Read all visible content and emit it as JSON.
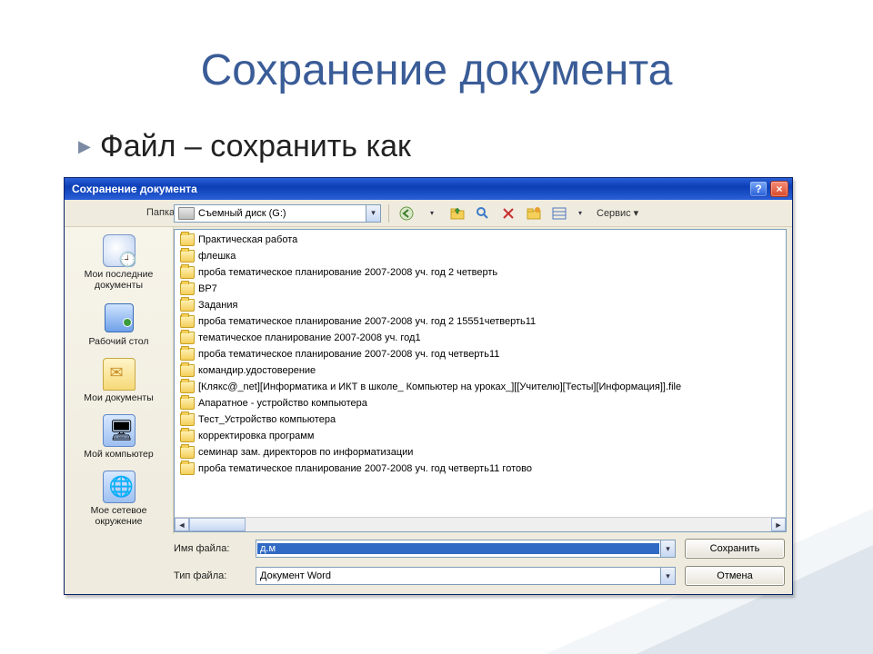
{
  "slide": {
    "title": "Сохранение документа",
    "bullet_prefix": "▶",
    "bullet_text": "Файл – сохранить как"
  },
  "dialog": {
    "title": "Сохранение документа",
    "help_btn": "?",
    "close_btn": "×",
    "folder_label": "Папка:",
    "folder_value": "Съемный диск (G:)",
    "toolbar": {
      "tools_label": "Сервис",
      "tools_arrow": "▾"
    },
    "places": [
      {
        "label": "Мои последние документы"
      },
      {
        "label": "Рабочий стол"
      },
      {
        "label": "Мои документы"
      },
      {
        "label": "Мой компьютер"
      },
      {
        "label": "Мое сетевое окружение"
      }
    ],
    "files": [
      {
        "t": "folder",
        "name": "Практическая работа"
      },
      {
        "t": "folder",
        "name": "флешка"
      },
      {
        "t": "folder",
        "name": "проба тематическое планирование 2007-2008 уч. год 2 четверть"
      },
      {
        "t": "folder",
        "name": "ВР7"
      },
      {
        "t": "folder",
        "name": "Задания"
      },
      {
        "t": "folder",
        "name": "проба тематическое планирование 2007-2008 уч. год 2 15551четверть11"
      },
      {
        "t": "folder",
        "name": "тематическое планирование 2007-2008 уч. год1"
      },
      {
        "t": "folder",
        "name": "проба тематическое планирование 2007-2008 уч. год четверть11"
      },
      {
        "t": "folder",
        "name": "командир.удостоверение"
      },
      {
        "t": "folder",
        "name": "[Клякс@_net][Информатика и ИКТ в школе_ Компьютер на уроках_][[Учителю][Тесты][Информация]].file"
      },
      {
        "t": "folder",
        "name": "Апаратное - устройство компьютера"
      },
      {
        "t": "folder",
        "name": "Тест_Устройство компьютера"
      },
      {
        "t": "folder",
        "name": "корректировка программ"
      },
      {
        "t": "folder",
        "name": "семинар зам. директоров по информатизации"
      },
      {
        "t": "folder",
        "name": "проба тематическое планирование 2007-2008 уч. год четверть11 готово"
      }
    ],
    "scroll_left": "◄",
    "scroll_right": "►",
    "filename_label": "Имя файла:",
    "filename_value": "д.м",
    "filetype_label": "Тип файла:",
    "filetype_value": "Документ Word",
    "save_btn": "Сохранить",
    "cancel_btn": "Отмена",
    "dd_arrow": "▾"
  }
}
